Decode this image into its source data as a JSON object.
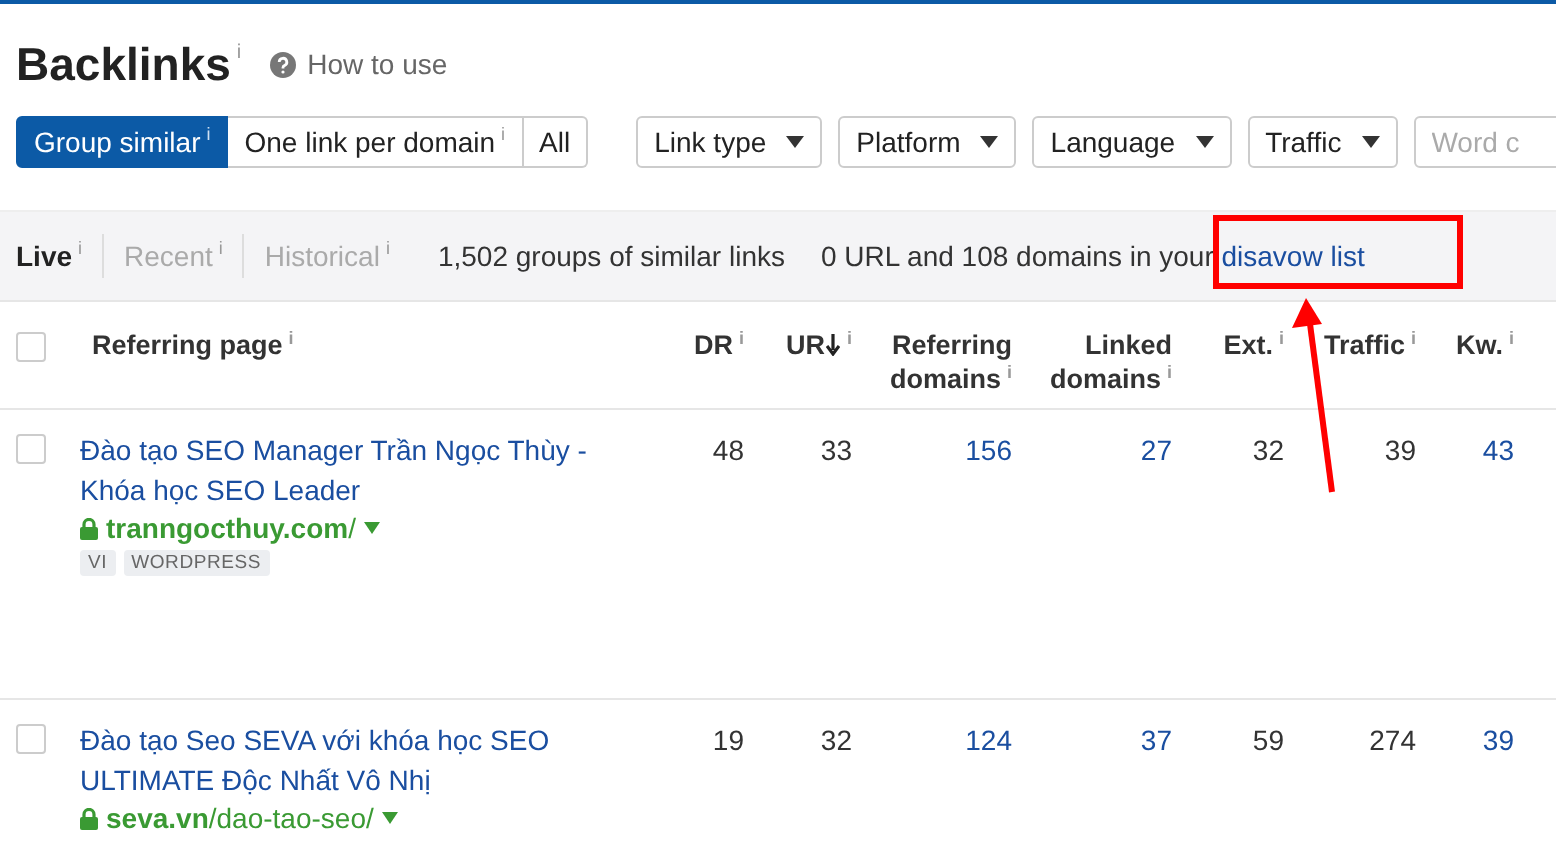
{
  "header": {
    "title": "Backlinks",
    "title_info": "i",
    "help": "How to use"
  },
  "grouping": [
    {
      "label": "Group similar",
      "info": "i",
      "selected": true
    },
    {
      "label": "One link per domain",
      "info": "i",
      "selected": false
    },
    {
      "label": "All",
      "selected": false
    }
  ],
  "filters": [
    "Link type",
    "Platform",
    "Language",
    "Traffic"
  ],
  "search": {
    "placeholder": "Word c"
  },
  "modes": [
    {
      "label": "Live",
      "info": "i",
      "selected": true
    },
    {
      "label": "Recent",
      "info": "i",
      "selected": false
    },
    {
      "label": "Historical",
      "info": "i",
      "selected": false
    }
  ],
  "summary": "1,502 groups of similar links",
  "disavow": {
    "text": "0 URL and 108 domains in your",
    "link": "disavow list"
  },
  "annotation": {
    "highlighted": true
  },
  "table": {
    "select_all": {
      "checked": false
    },
    "columns": [
      {
        "label": "Referring page",
        "info": "i"
      },
      {
        "label": "DR",
        "info": "i"
      },
      {
        "label": "UR",
        "info": "i",
        "sorted": true
      },
      {
        "label": "Referring domains",
        "info": "i",
        "link": true
      },
      {
        "label": "Linked domains",
        "info": "i",
        "link": true
      },
      {
        "label": "Ext.",
        "info": "i"
      },
      {
        "label": "Traffic",
        "info": "i"
      },
      {
        "label": "Kw.",
        "info": "i",
        "link": true
      }
    ],
    "rows": [
      {
        "checked": false,
        "title": "Đào tạo SEO Manager Trần Ngọc Thùy - Khóa học SEO Leader",
        "domain": "tranngocthuy.com",
        "path": "/",
        "tags": [
          "VI",
          "WORDPRESS"
        ],
        "values": [
          "48",
          "33",
          "156",
          "27",
          "32",
          "39",
          "43"
        ]
      },
      {
        "checked": false,
        "title": "Đào tạo Seo SEVA với khóa học SEO ULTIMATE Độc Nhất Vô Nhị",
        "domain": "seva.vn",
        "path": "/dao-tao-seo/",
        "tags": [],
        "values": [
          "19",
          "32",
          "124",
          "37",
          "59",
          "274",
          "39"
        ]
      }
    ]
  }
}
